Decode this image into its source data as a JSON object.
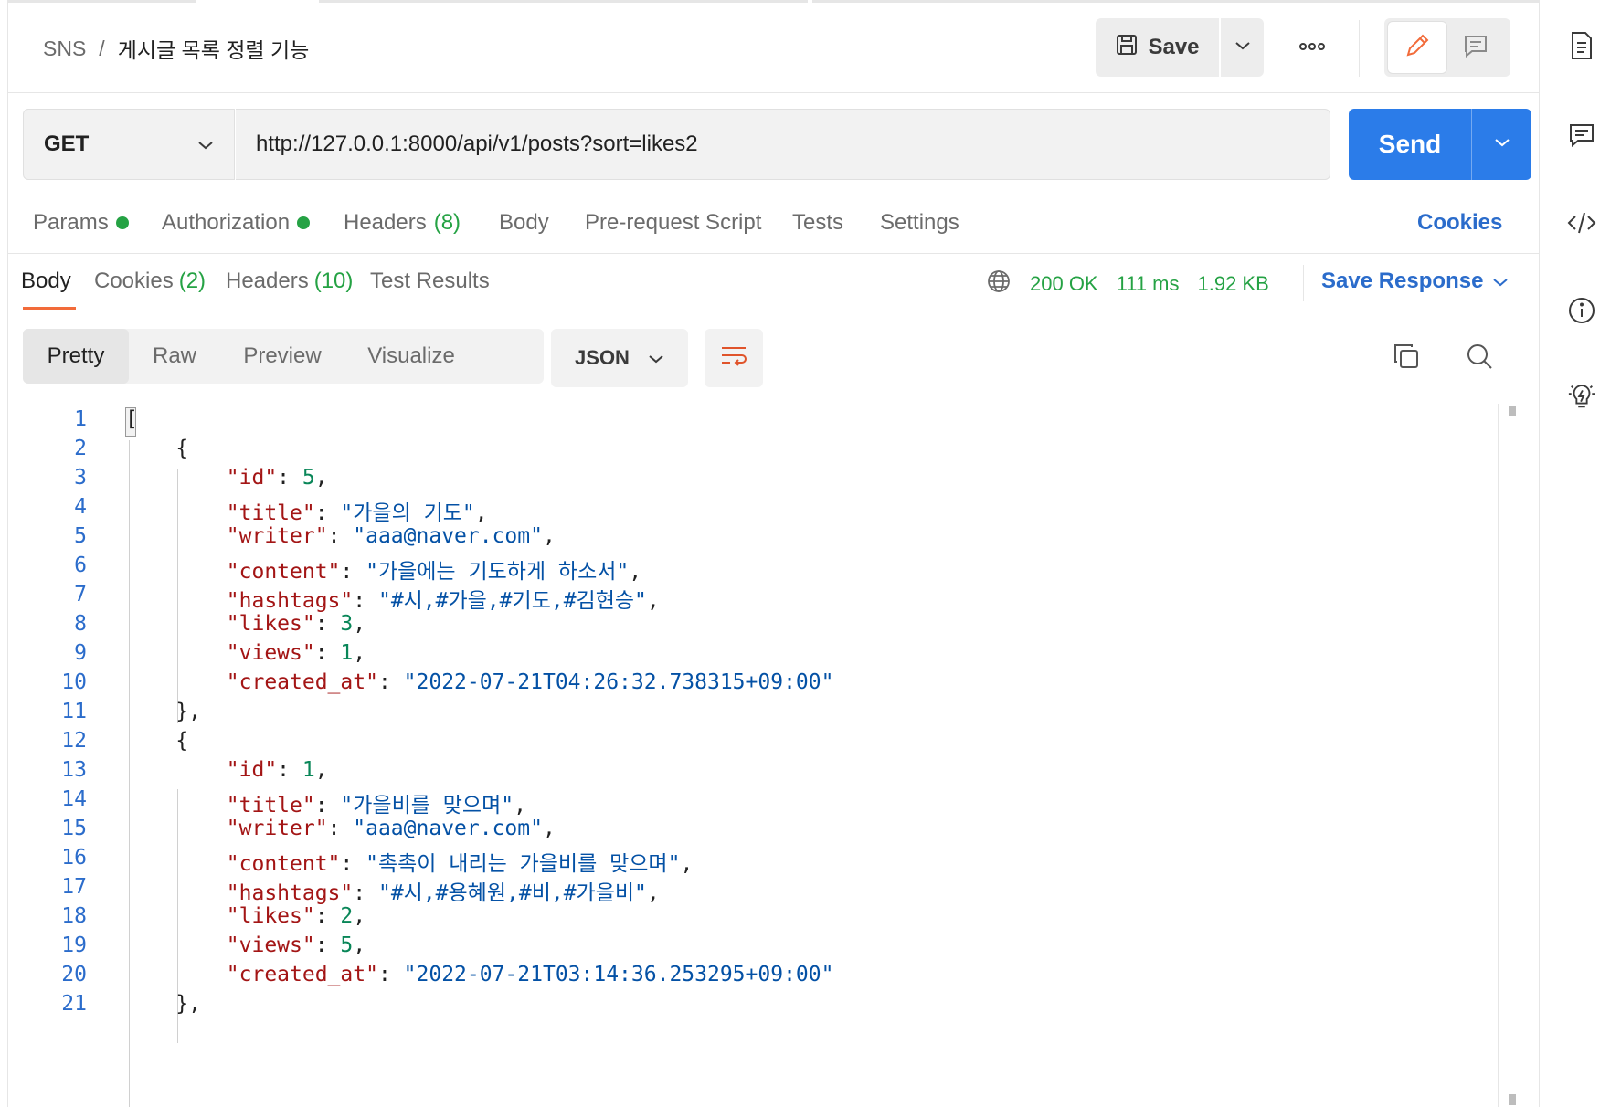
{
  "breadcrumb": {
    "parent": "SNS",
    "separator": "/",
    "current": "게시글 목록 정렬 기능"
  },
  "toolbar": {
    "save_label": "Save"
  },
  "request": {
    "method": "GET",
    "url": "http://127.0.0.1:8000/api/v1/posts?sort=likes2",
    "send_label": "Send"
  },
  "request_tabs": {
    "params": "Params",
    "authorization": "Authorization",
    "headers": "Headers",
    "headers_count": "(8)",
    "body": "Body",
    "prerequest": "Pre-request Script",
    "tests": "Tests",
    "settings": "Settings",
    "cookies": "Cookies"
  },
  "response_tabs": {
    "body": "Body",
    "cookies": "Cookies",
    "cookies_count": "(2)",
    "headers": "Headers",
    "headers_count": "(10)",
    "test_results": "Test Results"
  },
  "status": {
    "code": "200 OK",
    "time": "111 ms",
    "size": "1.92 KB",
    "save_response": "Save Response"
  },
  "view_modes": [
    "Pretty",
    "Raw",
    "Preview",
    "Visualize"
  ],
  "format": "JSON",
  "line_numbers": [
    "1",
    "2",
    "3",
    "4",
    "5",
    "6",
    "7",
    "8",
    "9",
    "10",
    "11",
    "12",
    "13",
    "14",
    "15",
    "16",
    "17",
    "18",
    "19",
    "20",
    "21"
  ],
  "posts": [
    {
      "id": "5",
      "title": "\"가을의 기도\"",
      "writer": "\"aaa@naver.com\"",
      "content": "\"가을에는 기도하게 하소서\"",
      "hashtags": "\"#시,#가을,#기도,#김현승\"",
      "likes": "3",
      "views": "1",
      "created_at": "\"2022-07-21T04:26:32.738315+09:00\""
    },
    {
      "id": "1",
      "title": "\"가을비를 맞으며\"",
      "writer": "\"aaa@naver.com\"",
      "content": "\"촉촉이 내리는 가을비를 맞으며\"",
      "hashtags": "\"#시,#용혜원,#비,#가을비\"",
      "likes": "2",
      "views": "5",
      "created_at": "\"2022-07-21T03:14:36.253295+09:00\""
    }
  ],
  "keys": {
    "id": "\"id\"",
    "title": "\"title\"",
    "writer": "\"writer\"",
    "content": "\"content\"",
    "hashtags": "\"hashtags\"",
    "likes": "\"likes\"",
    "views": "\"views\"",
    "created_at": "\"created_at\""
  },
  "icons": {
    "save": "floppy-disk-icon",
    "more": "more-dots-icon",
    "edit": "pencil-icon",
    "comment": "comment-icon",
    "globe": "globe-icon",
    "wrap": "wrap-lines-icon",
    "copy": "copy-icon",
    "search": "search-icon",
    "doc": "documentation-icon",
    "comments": "comments-icon",
    "code": "code-icon",
    "info": "info-icon",
    "bulb": "lightbulb-icon"
  },
  "colors": {
    "accent": "#2b7ce9",
    "success": "#25a244",
    "link": "#2b6ccb",
    "active_tab": "#f26b3a",
    "json_key": "#a31515",
    "json_string": "#0451a5",
    "json_number": "#098658"
  }
}
